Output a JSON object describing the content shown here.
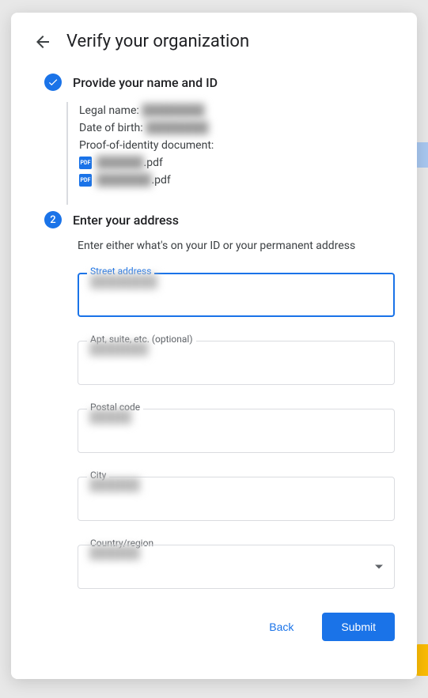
{
  "header": {
    "title": "Verify your organization"
  },
  "step1": {
    "label": "Provide your name and ID",
    "legal_name_label": "Legal name:",
    "legal_name_value": "████████",
    "dob_label": "Date of birth:",
    "dob_value": "████████",
    "doc_label": "Proof-of-identity document:",
    "file1_blur": "██████",
    "file1_ext": ".pdf",
    "file2_blur": "███████",
    "file2_ext": ".pdf",
    "pdf_icon_text": "PDF"
  },
  "step2": {
    "number": "2",
    "label": "Enter your address",
    "hint": "Enter either what's on your ID or your permanent address",
    "fields": {
      "street": {
        "label": "Street address",
        "value": "████████"
      },
      "apt": {
        "label": "Apt, suite, etc. (optional)",
        "value": "███████"
      },
      "postal": {
        "label": "Postal code",
        "value": "█████"
      },
      "city": {
        "label": "City",
        "value": "██████"
      },
      "country": {
        "label": "Country/region",
        "value": "██████"
      }
    }
  },
  "actions": {
    "back": "Back",
    "submit": "Submit"
  }
}
